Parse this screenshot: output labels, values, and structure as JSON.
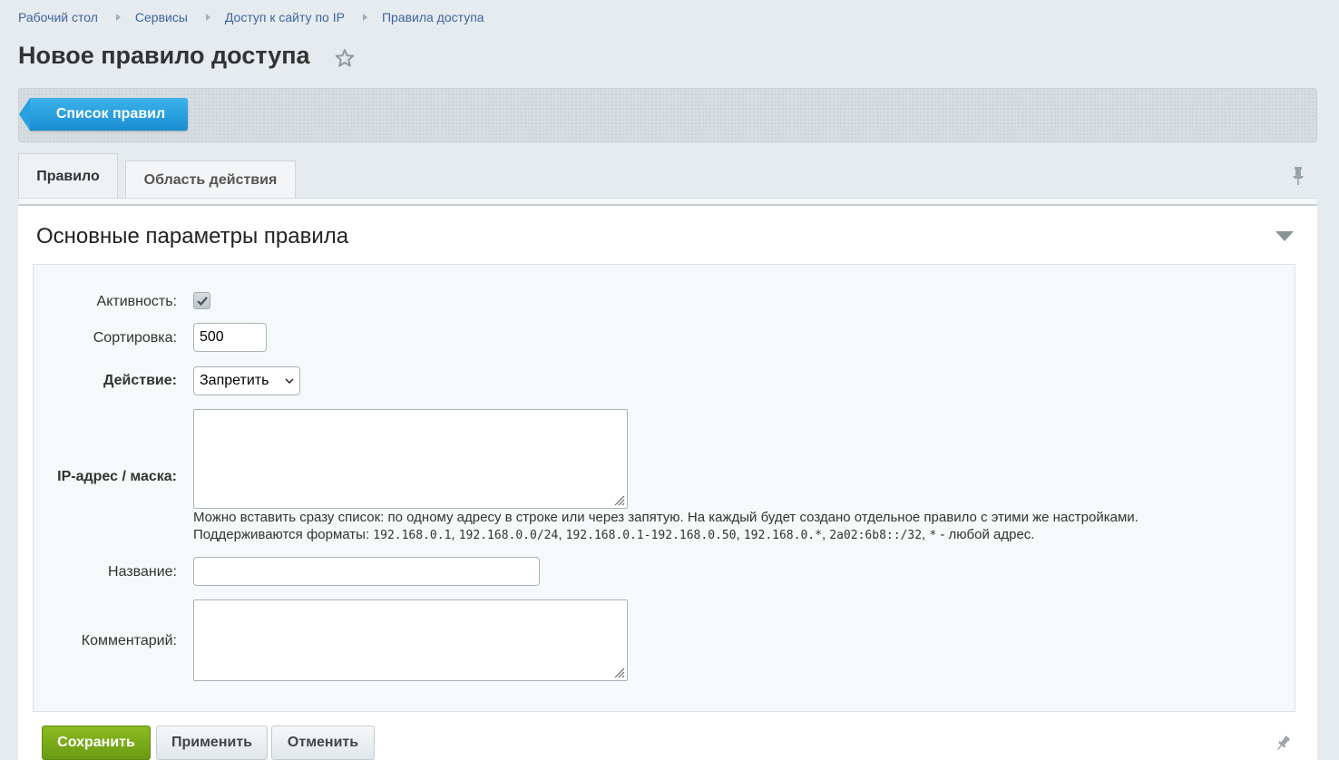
{
  "breadcrumb": [
    "Рабочий стол",
    "Сервисы",
    "Доступ к сайту по IP",
    "Правила доступа"
  ],
  "page_title": "Новое правило доступа",
  "toolbar": {
    "list_button": "Список правил"
  },
  "tabs": [
    {
      "label": "Правило",
      "active": true
    },
    {
      "label": "Область действия",
      "active": false
    }
  ],
  "section": {
    "title": "Основные параметры правила"
  },
  "form": {
    "active_label": "Активность:",
    "active_checked": true,
    "sort_label": "Сортировка:",
    "sort_value": "500",
    "action_label": "Действие:",
    "action_value": "Запретить",
    "ip_label": "IP-адрес / маска:",
    "ip_value": "",
    "hint_line1": "Можно вставить сразу список: по одному адресу в строке или через запятую. На каждый будет создано отдельное правило с этими же настройками.",
    "hint_prefix": "Поддерживаются форматы: ",
    "hint_formats": [
      "192.168.0.1",
      "192.168.0.0/24",
      "192.168.0.1-192.168.0.50",
      "192.168.0.*",
      "2a02:6b8::/32",
      "*"
    ],
    "hint_suffix": " - любой адрес.",
    "name_label": "Название:",
    "name_value": "",
    "comment_label": "Комментарий:",
    "comment_value": ""
  },
  "footer": {
    "save": "Сохранить",
    "apply": "Применить",
    "cancel": "Отменить"
  },
  "colors": {
    "save_green": "#7aaa18",
    "list_blue": "#1f98da",
    "link_blue": "#3f64a0"
  }
}
